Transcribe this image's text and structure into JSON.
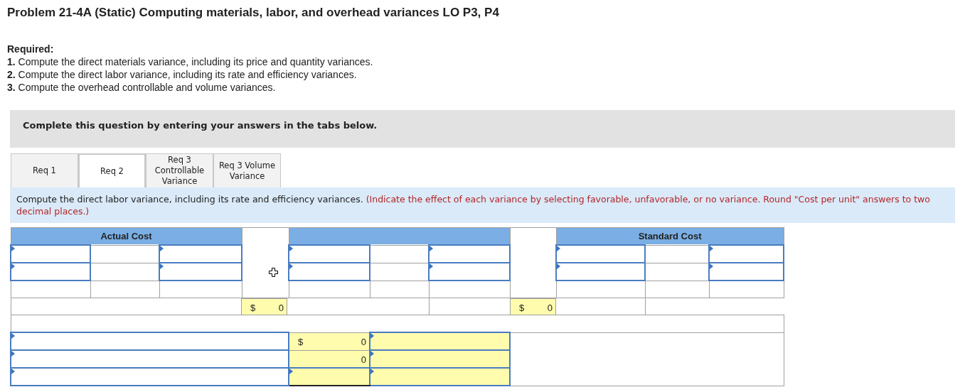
{
  "title": "Problem 21-4A (Static) Computing materials, labor, and overhead variances LO P3, P4",
  "required_label": "Required:",
  "requirements": [
    {
      "number": "1.",
      "text": "Compute the direct materials variance, including its price and quantity variances."
    },
    {
      "number": "2.",
      "text": "Compute the direct labor variance, including its rate and efficiency variances."
    },
    {
      "number": "3.",
      "text": "Compute the overhead controllable and volume variances."
    }
  ],
  "instruction": "Complete this question by entering your answers in the tabs below.",
  "tabs": [
    {
      "label": "Req 1",
      "selected": false
    },
    {
      "label": "Req 2",
      "selected": true
    },
    {
      "label": "Req 3 Controllable Variance",
      "selected": false
    },
    {
      "label": "Req 3 Volume Variance",
      "selected": false
    }
  ],
  "prompt": {
    "text": "Compute the direct labor variance, including its rate and efficiency variances.",
    "note": "(Indicate the effect of each variance by selecting favorable, unfavorable, or no variance. Round \"Cost per unit\" answers to two decimal places.)"
  },
  "table": {
    "actual_cost_header": "Actual Cost",
    "standard_cost_header": "Standard Cost",
    "totals": [
      {
        "symbol": "$",
        "value": "0"
      },
      {
        "symbol": "$",
        "value": "0"
      }
    ],
    "variance_rows": [
      {
        "symbol": "$",
        "value": "0"
      },
      {
        "value": "0"
      }
    ]
  }
}
